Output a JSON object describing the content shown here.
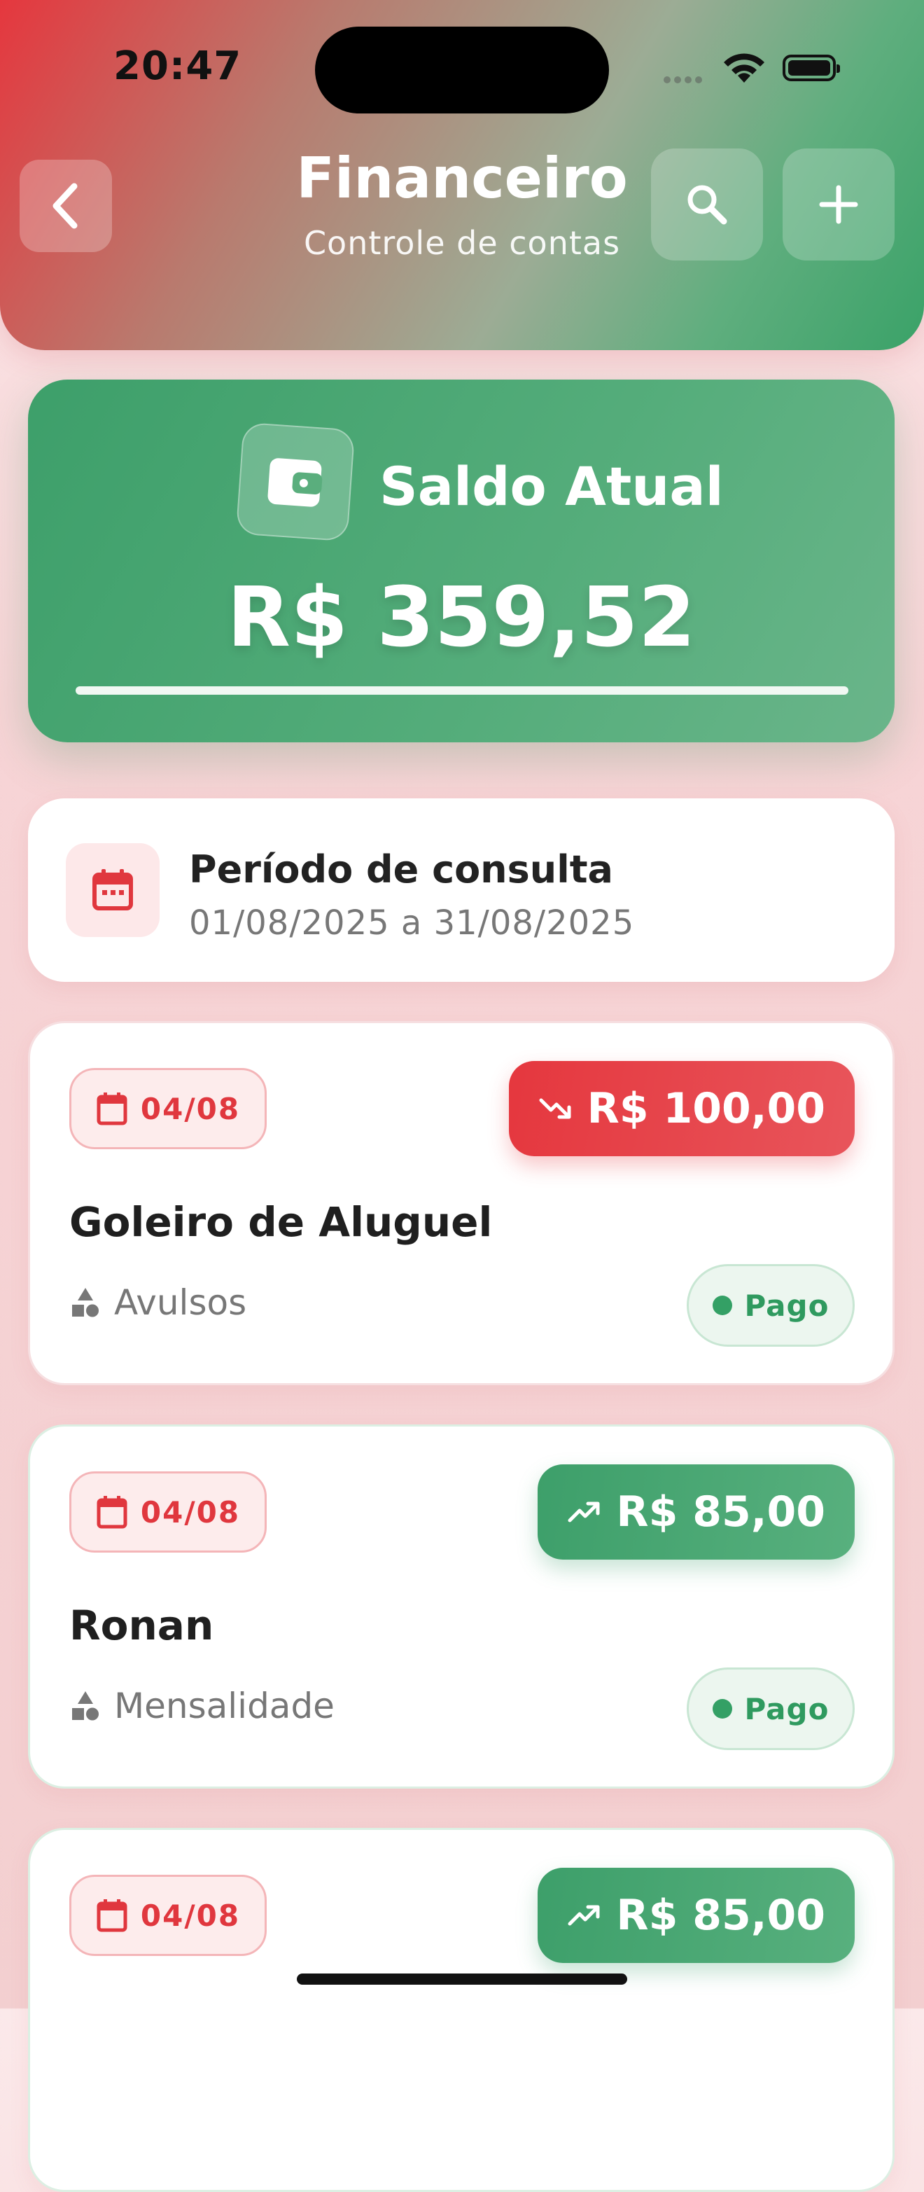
{
  "status_bar": {
    "time": "20:47"
  },
  "header": {
    "title": "Financeiro",
    "subtitle": "Controle de contas",
    "back_icon": "chevron-left-icon",
    "search_icon": "search-icon",
    "add_icon": "plus-icon"
  },
  "balance": {
    "label": "Saldo Atual",
    "value": "R$ 359,52",
    "icon": "wallet-icon"
  },
  "period": {
    "title": "Período de consulta",
    "range": "01/08/2025 a 31/08/2025",
    "icon": "calendar-icon"
  },
  "transactions": [
    {
      "date": "04/08",
      "amount": "R$ 100,00",
      "type": "expense",
      "trend_icon": "trending-down-icon",
      "name": "Goleiro de Aluguel",
      "category": "Avulsos",
      "status": "Pago"
    },
    {
      "date": "04/08",
      "amount": "R$ 85,00",
      "type": "income",
      "trend_icon": "trending-up-icon",
      "name": "Ronan",
      "category": "Mensalidade",
      "status": "Pago"
    },
    {
      "date": "04/08",
      "amount": "R$ 85,00",
      "type": "income",
      "trend_icon": "trending-up-icon",
      "name": "",
      "category": "",
      "status": ""
    }
  ],
  "colors": {
    "expense": "#e5373e",
    "income": "#3d9f6a",
    "accent_red": "#e0373e"
  }
}
